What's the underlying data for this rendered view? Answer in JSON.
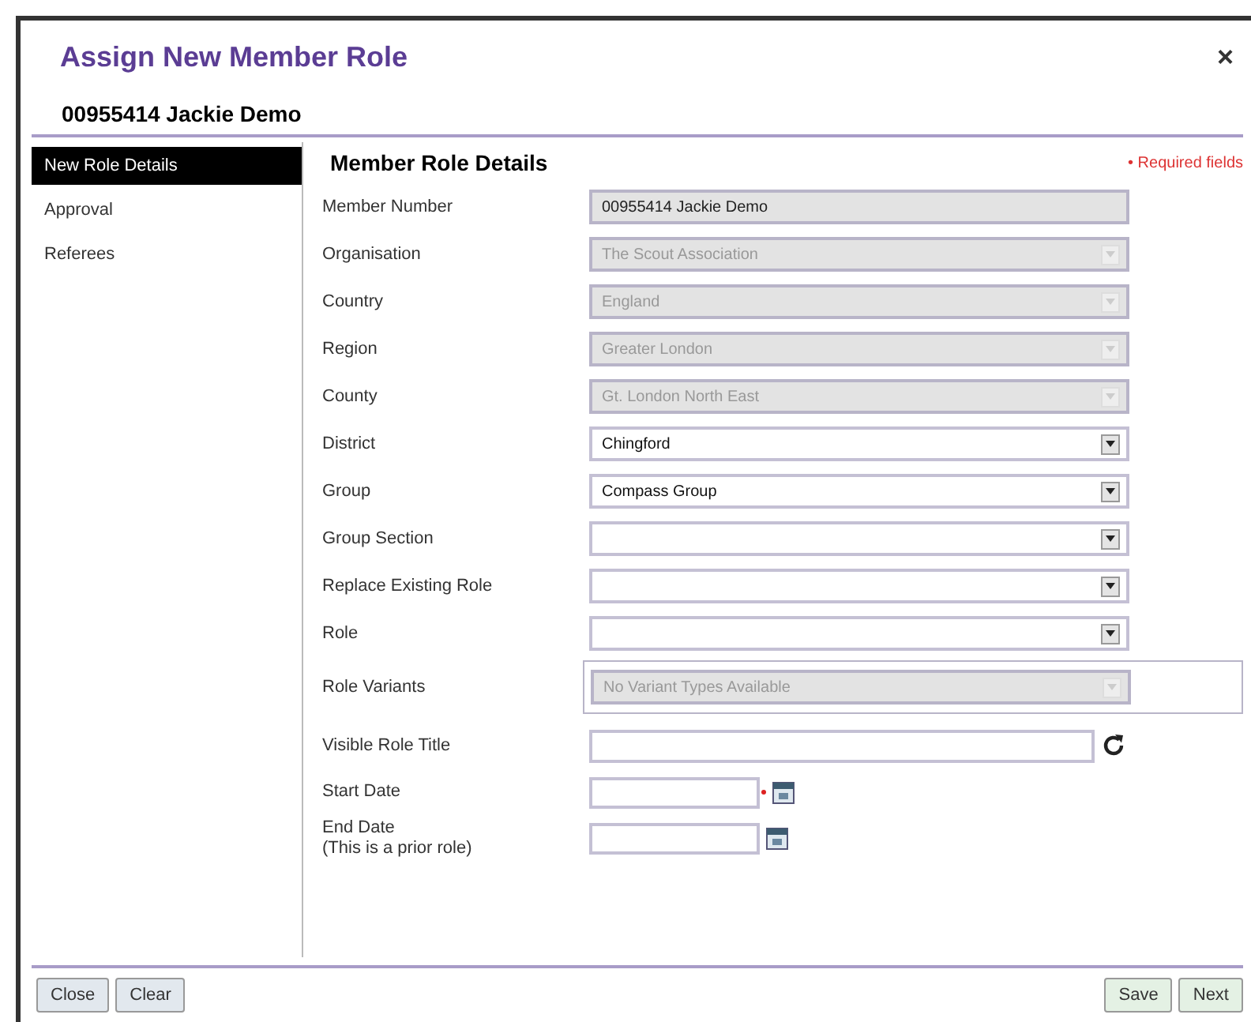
{
  "dialog": {
    "title": "Assign New Member Role",
    "close": "×",
    "subtitle": "00955414 Jackie Demo"
  },
  "sidebar": {
    "items": [
      {
        "label": "New Role Details",
        "selected": true
      },
      {
        "label": "Approval",
        "selected": false
      },
      {
        "label": "Referees",
        "selected": false
      }
    ]
  },
  "form": {
    "heading": "Member Role Details",
    "required_note": "• Required fields",
    "fields": [
      {
        "kind": "text",
        "label": "Member Number",
        "value": "00955414 Jackie Demo",
        "disabled": true
      },
      {
        "kind": "select",
        "label": "Organisation",
        "value": "The Scout Association",
        "disabled": true
      },
      {
        "kind": "select",
        "label": "Country",
        "value": "England",
        "disabled": true
      },
      {
        "kind": "select",
        "label": "Region",
        "value": "Greater London",
        "disabled": true
      },
      {
        "kind": "select",
        "label": "County",
        "value": "Gt. London North East",
        "disabled": true
      },
      {
        "kind": "select",
        "label": "District",
        "value": "Chingford",
        "disabled": false
      },
      {
        "kind": "select",
        "label": "Group",
        "value": "Compass Group",
        "disabled": false
      },
      {
        "kind": "select",
        "label": "Group Section",
        "disabled": false
      },
      {
        "kind": "select",
        "label": "Replace Existing Role",
        "disabled": false
      },
      {
        "kind": "select",
        "label": "Role",
        "disabled": false
      },
      {
        "kind": "variants",
        "label": "Role Variants",
        "value": "No Variant Types Available",
        "disabled": true
      },
      {
        "kind": "title",
        "label": "Visible Role Title"
      },
      {
        "kind": "date",
        "label": "Start Date",
        "required": true
      },
      {
        "kind": "date",
        "label": "End Date",
        "note": "(This is a prior role)"
      }
    ]
  },
  "footer": {
    "left_buttons": [
      "Close",
      "Clear"
    ],
    "right_buttons": [
      "Save",
      "Next"
    ]
  }
}
